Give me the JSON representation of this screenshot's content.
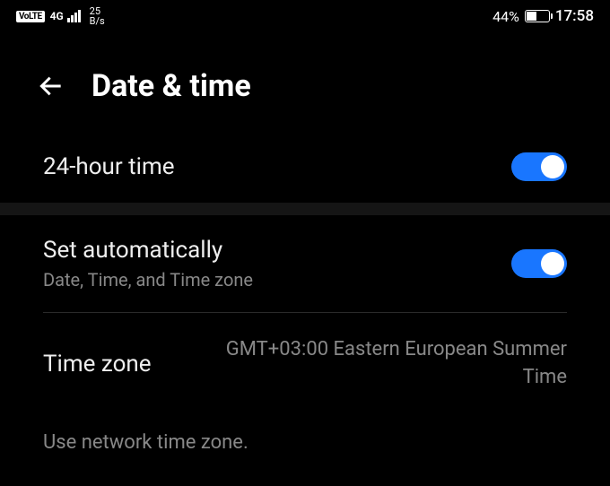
{
  "status": {
    "volte": "VoLTE",
    "network": "4G",
    "speed_num": "25",
    "speed_unit": "B/s",
    "battery_pct": "44%",
    "time": "17:58"
  },
  "header": {
    "title": "Date & time"
  },
  "settings": {
    "hour24": {
      "label": "24-hour time",
      "on": true
    },
    "auto": {
      "label": "Set automatically",
      "sub": "Date, Time, and Time zone",
      "on": true
    },
    "timezone": {
      "label": "Time zone",
      "value": "GMT+03:00 Eastern European Summer Time"
    },
    "footer": "Use network time zone."
  }
}
